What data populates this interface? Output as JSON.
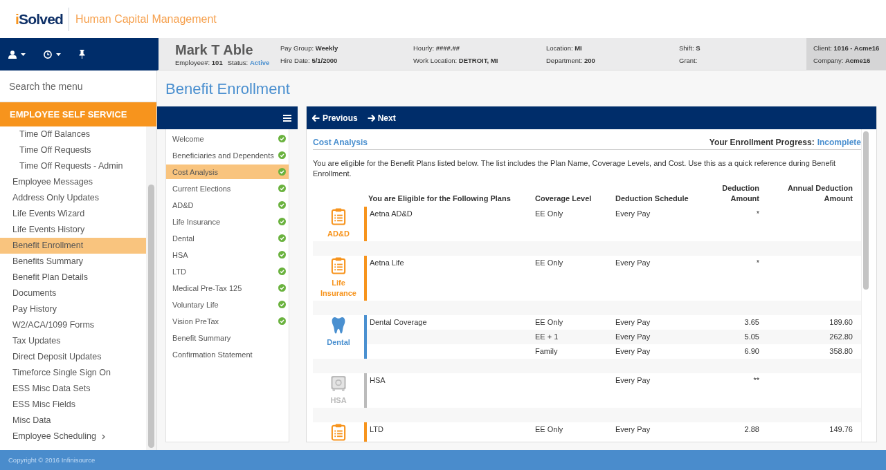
{
  "header": {
    "logo_accent": "i",
    "logo_text": "Solved",
    "product": "Human Capital Management"
  },
  "employee": {
    "name": "Mark T Able",
    "number_label": "Employee#:",
    "number": "101",
    "status_label": "Status:",
    "status": "Active"
  },
  "info_columns": [
    [
      {
        "label": "Pay Group:",
        "value": "Weekly"
      },
      {
        "label": "Hire Date:",
        "value": "5/1/2000"
      }
    ],
    [
      {
        "label": "Hourly:",
        "value": "####.##"
      },
      {
        "label": "Work Location:",
        "value": "DETROIT, MI"
      }
    ],
    [
      {
        "label": "Location:",
        "value": "MI"
      },
      {
        "label": "Department:",
        "value": "200"
      }
    ],
    [
      {
        "label": "Shift:",
        "value": "S"
      },
      {
        "label": "Grant:"
      }
    ]
  ],
  "client_info": [
    {
      "label": "Client:",
      "value": "1016 - Acme16"
    },
    {
      "label": "Company:",
      "value": "Acme16"
    }
  ],
  "sidebar": {
    "search": {
      "placeholder": "Search the menu"
    },
    "section": "EMPLOYEE SELF SERVICE",
    "items": [
      {
        "children": [
          {
            "label": "Time Off Balances",
            "selected": false,
            "submenu": false
          },
          {
            "label": "Time Off Requests",
            "selected": false,
            "submenu": false
          },
          {
            "label": "Time Off Requests - Admin",
            "selected": false,
            "submenu": false
          }
        ]
      },
      {
        "label": "Employee Messages",
        "selected": false,
        "submenu": false
      },
      {
        "label": "Address Only Updates",
        "selected": false,
        "submenu": false
      },
      {
        "label": "Life Events Wizard",
        "selected": false,
        "submenu": false
      },
      {
        "label": "Life Events History",
        "selected": false,
        "submenu": false
      },
      {
        "label": "Benefit Enrollment",
        "selected": true,
        "submenu": false
      },
      {
        "label": "Benefits Summary",
        "selected": false,
        "submenu": false
      },
      {
        "label": "Benefit Plan Details",
        "selected": false,
        "submenu": false
      },
      {
        "label": "Documents",
        "selected": false,
        "submenu": false
      },
      {
        "label": "Pay History",
        "selected": false,
        "submenu": false
      },
      {
        "label": "W2/ACA/1099 Forms",
        "selected": false,
        "submenu": false
      },
      {
        "label": "Tax Updates",
        "selected": false,
        "submenu": false
      },
      {
        "label": "Direct Deposit Updates",
        "selected": false,
        "submenu": false
      },
      {
        "label": "Timeforce Single Sign On",
        "selected": false,
        "submenu": false
      },
      {
        "label": "ESS Misc Data Sets",
        "selected": false,
        "submenu": false
      },
      {
        "label": "ESS Misc Fields",
        "selected": false,
        "submenu": false
      },
      {
        "label": "Misc Data",
        "selected": false,
        "submenu": false
      },
      {
        "label": "Employee Scheduling",
        "selected": false,
        "submenu": true
      }
    ]
  },
  "page_title": "Benefit Enrollment",
  "steps": [
    {
      "label": "Welcome",
      "selected": false,
      "completed": true
    },
    {
      "label": "Beneficiaries and Dependents",
      "selected": false,
      "completed": true
    },
    {
      "label": "Cost Analysis",
      "selected": true,
      "completed": true
    },
    {
      "label": "Current Elections",
      "selected": false,
      "completed": true
    },
    {
      "label": "AD&D",
      "selected": false,
      "completed": true
    },
    {
      "label": "Life Insurance",
      "selected": false,
      "completed": true
    },
    {
      "label": "Dental",
      "selected": false,
      "completed": true
    },
    {
      "label": "HSA",
      "selected": false,
      "completed": true
    },
    {
      "label": "LTD",
      "selected": false,
      "completed": true
    },
    {
      "label": "Medical Pre-Tax 125",
      "selected": false,
      "completed": true
    },
    {
      "label": "Voluntary Life",
      "selected": false,
      "completed": true
    },
    {
      "label": "Vision PreTax",
      "selected": false,
      "completed": true
    },
    {
      "label": "Benefit Summary",
      "selected": false,
      "completed": false
    },
    {
      "label": "Confirmation Statement",
      "selected": false,
      "completed": false
    }
  ],
  "nav": {
    "previous": "Previous",
    "next": "Next"
  },
  "content": {
    "heading": "Cost Analysis",
    "progress": {
      "label": "Your Enrollment Progress:",
      "value": "Incomplete",
      "complete": false
    },
    "intro": "You are eligible for the Benefit Plans listed below. The list includes the Plan Name, Coverage Levels, and Cost. Use this as a quick reference during Benefit Enrollment.",
    "columns": [
      "You are Eligible for the Following Plans",
      "Coverage Level",
      "Deduction Schedule",
      "Deduction Amount",
      "Annual Deduction Amount"
    ],
    "groups": [
      {
        "kind": "insurance",
        "label": "AD&D",
        "color": "#f7941d",
        "rows": [
          {
            "plan": "Aetna AD&D",
            "coverage": "EE Only",
            "schedule": "Every Pay",
            "amount": "*"
          }
        ]
      },
      {
        "kind": "insurance",
        "label": "Life Insurance",
        "color": "#f7941d",
        "rows": [
          {
            "plan": "Aetna Life",
            "coverage": "EE Only",
            "schedule": "Every Pay",
            "amount": "*"
          }
        ]
      },
      {
        "kind": "dental",
        "label": "Dental",
        "color": "#4a90d0",
        "rows": [
          {
            "plan": "Dental Coverage",
            "coverage": "EE Only",
            "schedule": "Every Pay",
            "amount": "3.65",
            "annual": "189.60"
          },
          {
            "coverage": "EE + 1",
            "schedule": "Every Pay",
            "amount": "5.05",
            "annual": "262.80"
          },
          {
            "coverage": "Family",
            "schedule": "Every Pay",
            "amount": "6.90",
            "annual": "358.80"
          }
        ]
      },
      {
        "kind": "savings",
        "label": "HSA",
        "color": "#bbbbbb",
        "rows": [
          {
            "plan": "HSA",
            "schedule": "Every Pay",
            "amount": "**"
          }
        ]
      },
      {
        "kind": "insurance",
        "color": "#f7941d",
        "rows": [
          {
            "plan": "LTD",
            "coverage": "EE Only",
            "schedule": "Every Pay",
            "amount": "2.88",
            "annual": "149.76"
          }
        ]
      }
    ]
  },
  "footer": "Copyright © 2016 Infinisource"
}
